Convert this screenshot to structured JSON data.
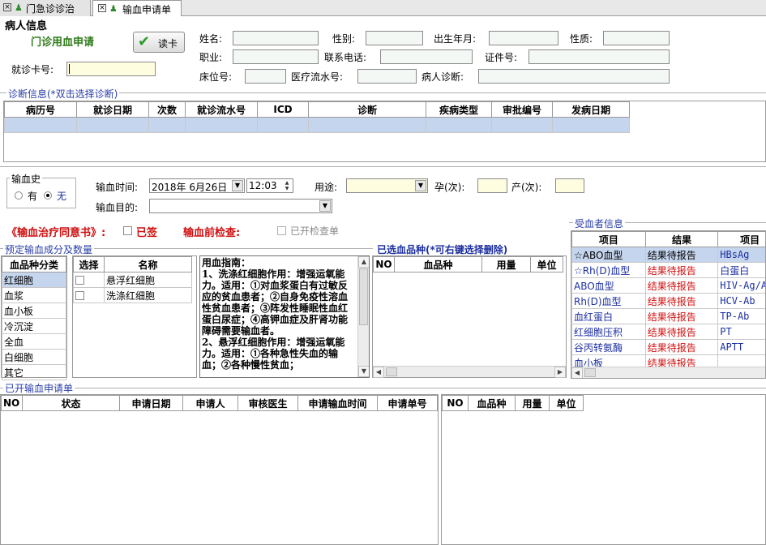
{
  "tabs": [
    {
      "label": "门急诊诊治",
      "active": false
    },
    {
      "label": "输血申请单",
      "active": true
    }
  ],
  "patient": {
    "section_title": "病人信息",
    "subtitle": "门诊用血申请",
    "read_card": "读卡",
    "card_no_label": "就诊卡号:",
    "name_label": "姓名:",
    "gender_label": "性别:",
    "birth_label": "出生年月:",
    "nature_label": "性质:",
    "job_label": "职业:",
    "phone_label": "联系电话:",
    "id_label": "证件号:",
    "bed_label": "床位号:",
    "serial_label": "医疗流水号:",
    "diag_label": "病人诊断:"
  },
  "diagnosis": {
    "title": "诊断信息(*双击选择诊断)",
    "columns": [
      "病历号",
      "就诊日期",
      "次数",
      "就诊流水号",
      "ICD",
      "诊断",
      "疾病类型",
      "审批编号",
      "发病日期"
    ]
  },
  "transfusion": {
    "history_title": "输血史",
    "yes": "有",
    "no": "无",
    "time_label": "输血时间:",
    "date_value": "2018年 6月26日",
    "time_value": "12:03",
    "purpose_label": "输血目的:",
    "use_label": "用途:",
    "pregnant_label": "孕(次):",
    "birth_count_label": "产(次):",
    "consent_label": "《输血治疗同意书》:",
    "signed_label": "已签",
    "pretest_label": "输血前检查:",
    "test_opened_label": "已开检查单"
  },
  "components": {
    "title": "预定输血成分及数量",
    "category_header": "血品种分类",
    "categories": [
      "红细胞",
      "血浆",
      "血小板",
      "冷沉淀",
      "全血",
      "白细胞",
      "其它"
    ],
    "select_header": "选择",
    "name_header": "名称",
    "items": [
      "悬浮红细胞",
      "洗涤红细胞"
    ],
    "guide_text": "用血指南：\n1、洗涤红细胞作用：增强运氧能力。适用：①对血浆蛋白有过敏反应的贫血患者；②自身免疫性溶血性贫血患者；③阵发性睡眠性血红蛋白尿症；④高钾血症及肝肾功能障碍需要输血者。\n2、悬浮红细胞作用：增强运氧能力。适用：①各种急性失血的输血；②各种慢性贫血；"
  },
  "selected": {
    "title": "已选血品种(*可右键选择删除)",
    "columns": [
      "NO",
      "血品种",
      "用量",
      "单位"
    ]
  },
  "recipient": {
    "title": "受血者信息",
    "columns": [
      "项目",
      "结果",
      "项目"
    ],
    "rows": [
      {
        "item": "☆ABO血型",
        "result": "结果待报告",
        "item2": "HBsAg"
      },
      {
        "item": "☆Rh(D)血型",
        "result": "结果待报告",
        "item2": "白蛋白"
      },
      {
        "item": "ABO血型",
        "result": "结果待报告",
        "item2": "HIV-Ag/A"
      },
      {
        "item": "Rh(D)血型",
        "result": "结果待报告",
        "item2": "HCV-Ab"
      },
      {
        "item": "血红蛋白",
        "result": "结果待报告",
        "item2": "TP-Ab"
      },
      {
        "item": "红细胞压积",
        "result": "结果待报告",
        "item2": "PT"
      },
      {
        "item": "谷丙转氨酶",
        "result": "结果待报告",
        "item2": "APTT"
      },
      {
        "item": "血小板",
        "result": "结果待报告",
        "item2": ""
      }
    ]
  },
  "requests": {
    "title": "已开输血申请单",
    "columns": [
      "NO",
      "状态",
      "申请日期",
      "申请人",
      "审核医生",
      "申请输血时间",
      "申请单号"
    ],
    "detail_columns": [
      "NO",
      "血品种",
      "用量",
      "单位"
    ]
  },
  "colors": {
    "accent_blue": "#2a3ea8",
    "highlight_row": "#c6d5ee",
    "result_red": "#d01010",
    "input_yellow": "#fffde0"
  }
}
